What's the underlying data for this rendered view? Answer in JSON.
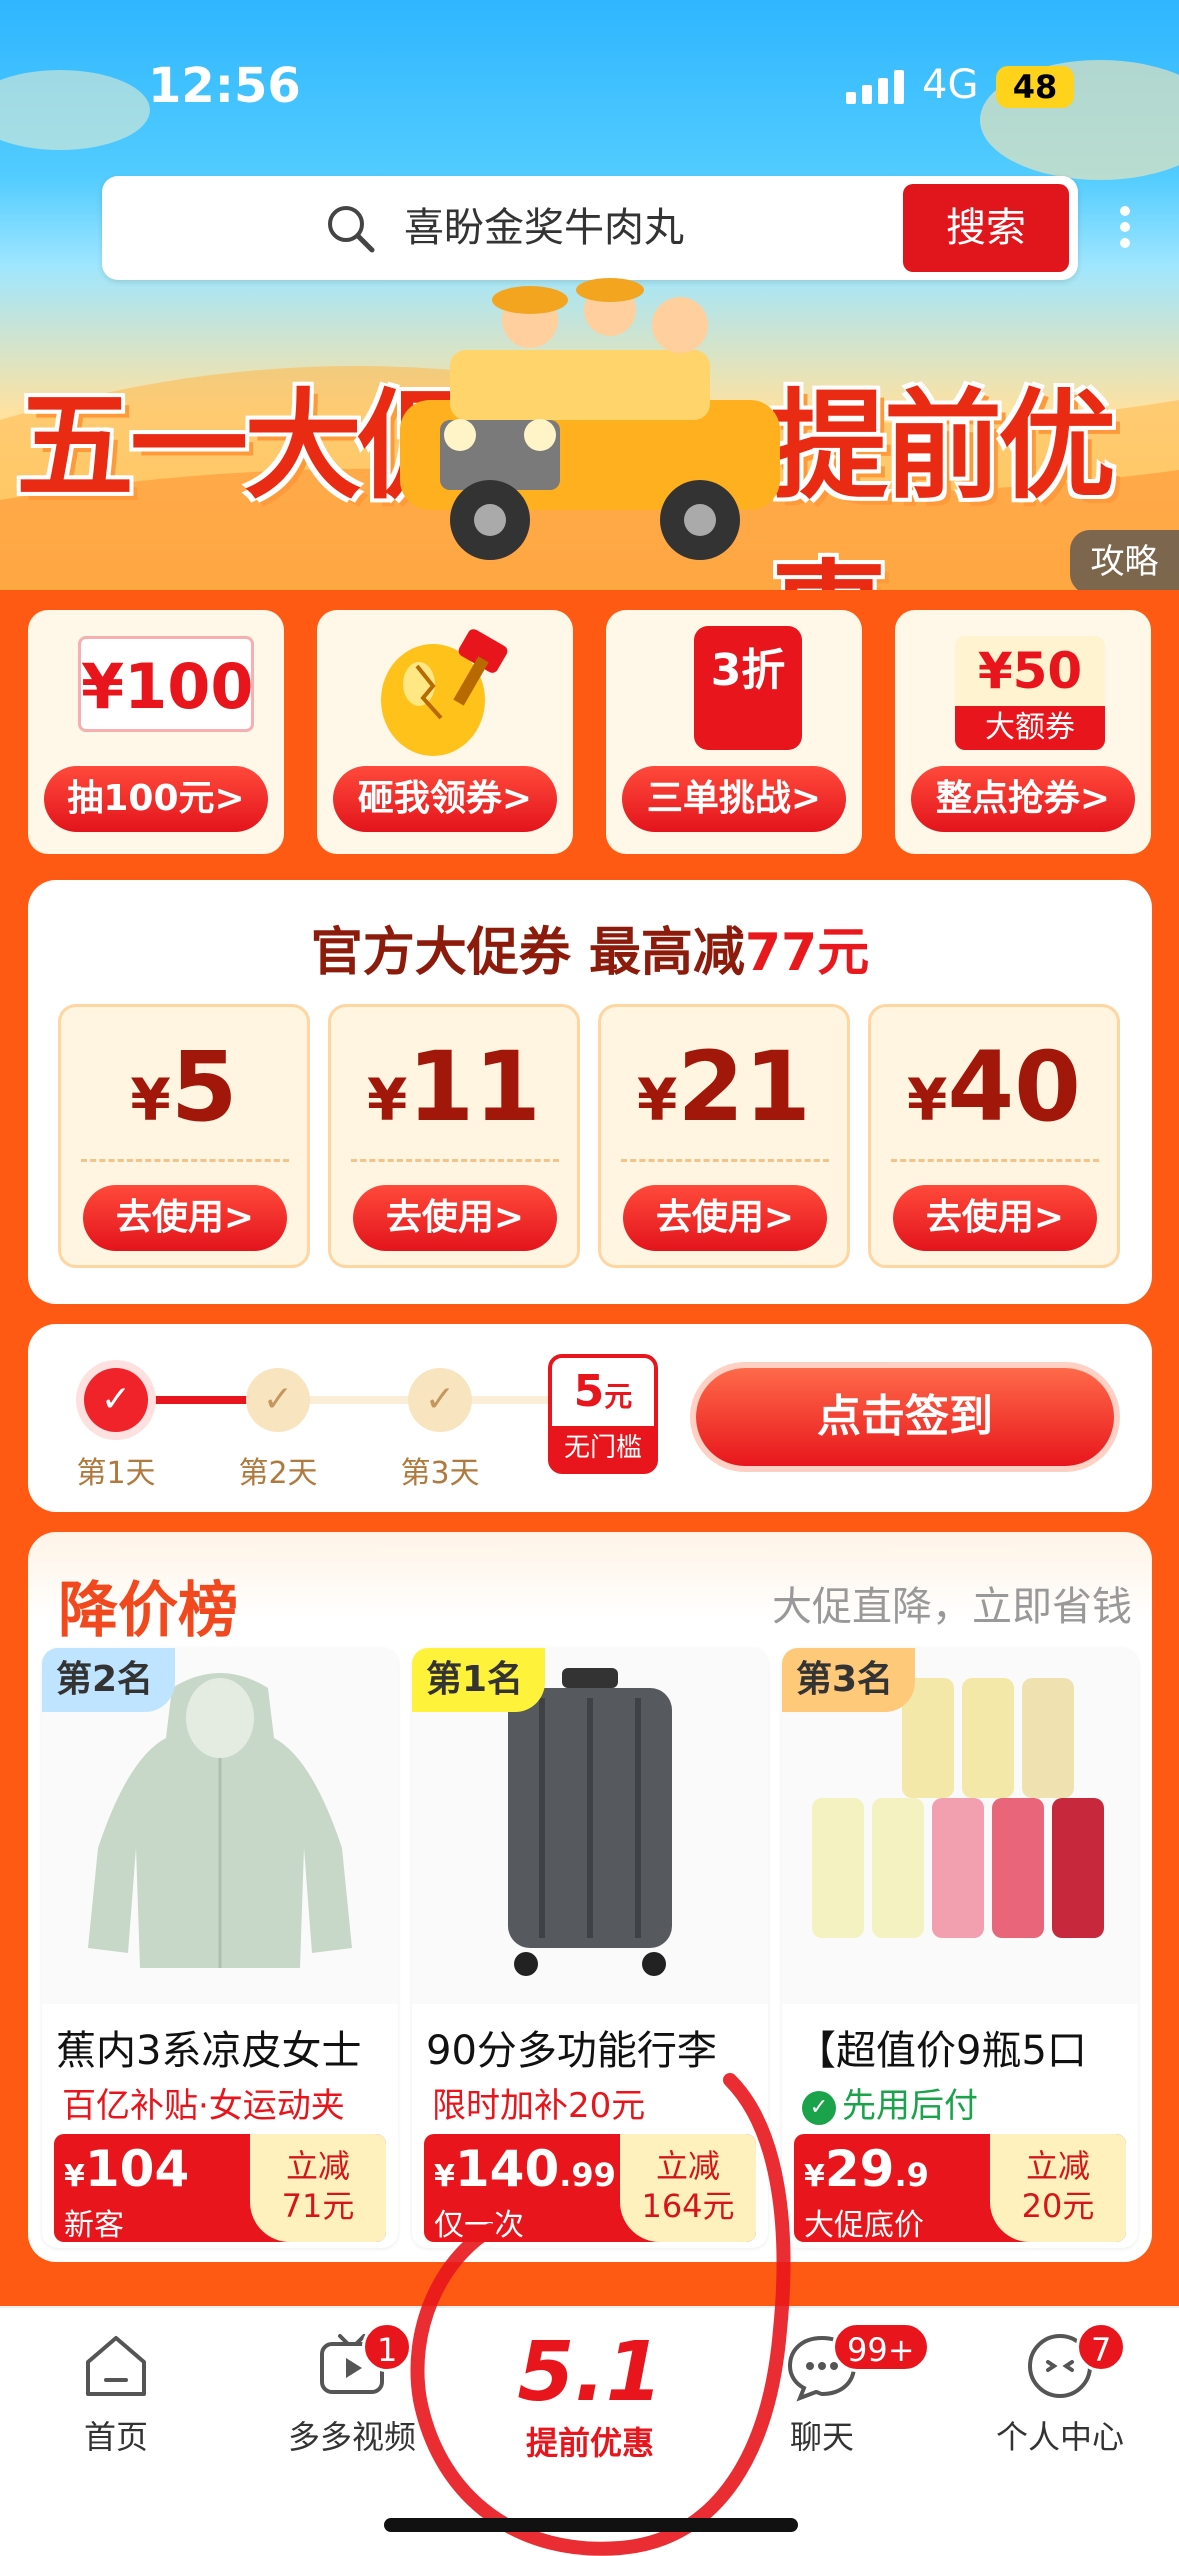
{
  "status": {
    "time": "12:56",
    "network": "4G",
    "battery": "48"
  },
  "search": {
    "query": "喜盼金奖牛肉丸",
    "button": "搜索"
  },
  "banner": {
    "left": "五一大促",
    "right": "提前优惠",
    "guide": "攻略"
  },
  "entries": [
    {
      "art": "¥100",
      "label": "抽100元>"
    },
    {
      "art": "",
      "label": "砸我领券>"
    },
    {
      "art": "3折",
      "label": "三单挑战>"
    },
    {
      "art": "¥50",
      "art_sub": "大额券",
      "label": "整点抢券>"
    }
  ],
  "coupons": {
    "title_prefix": "官方大促券 最高减",
    "title_amount": "77",
    "title_suffix": "元",
    "items": [
      {
        "yen": "¥",
        "value": "5",
        "button": "去使用>"
      },
      {
        "yen": "¥",
        "value": "11",
        "button": "去使用>"
      },
      {
        "yen": "¥",
        "value": "21",
        "button": "去使用>"
      },
      {
        "yen": "¥",
        "value": "40",
        "button": "去使用>"
      }
    ]
  },
  "checkin": {
    "days": [
      "第1天",
      "第2天",
      "第3天"
    ],
    "reward_amount": "5",
    "reward_unit": "元",
    "reward_sub": "无门槛",
    "button": "点击签到"
  },
  "ranking": {
    "title": "降价榜",
    "subtitle": "大促直降，立即省钱",
    "products": [
      {
        "rank": "第2名",
        "name": "蕉内3系凉皮女士",
        "tag": "百亿补贴·女运动夹",
        "yen": "¥",
        "price": "104",
        "price_dec": "",
        "note": "新客",
        "cut_label": "立减",
        "cut": "71元"
      },
      {
        "rank": "第1名",
        "name": "90分多功能行李",
        "tag": "限时加补20元",
        "yen": "¥",
        "price": "140",
        "price_dec": ".99",
        "note": "仅一次",
        "cut_label": "立减",
        "cut": "164元"
      },
      {
        "rank": "第3名",
        "name": "【超值价9瓶5口",
        "tag": "先用后付",
        "yen": "¥",
        "price": "29",
        "price_dec": ".9",
        "note": "大促底价",
        "cut_label": "立减",
        "cut": "20元"
      }
    ]
  },
  "tabbar": {
    "items": [
      {
        "label": "首页"
      },
      {
        "label": "多多视频",
        "badge": "1"
      },
      {
        "label": "提前优惠",
        "logo": "5.1"
      },
      {
        "label": "聊天",
        "badge": "99+"
      },
      {
        "label": "个人中心",
        "badge": "7"
      }
    ]
  },
  "colors": {
    "accent": "#e8161c",
    "background": "#ff5a14",
    "brown": "#8c1b0b"
  }
}
